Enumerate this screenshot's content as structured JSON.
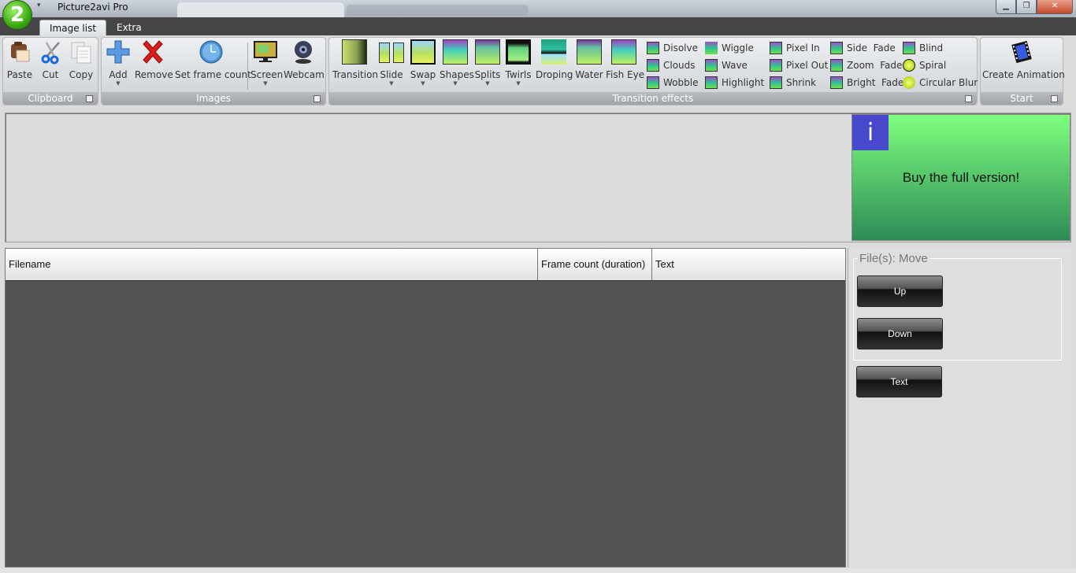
{
  "window": {
    "title": "Picture2avi Pro",
    "logo_glyph": "2",
    "qat_glyph": "▾",
    "controls": {
      "minimize": "▁",
      "maximize": "❐",
      "close": "✕"
    }
  },
  "tabs": [
    {
      "label": "Image list",
      "active": true
    },
    {
      "label": "Extra",
      "active": false
    }
  ],
  "ribbon": {
    "groups": {
      "clipboard": {
        "label": "Clipboard",
        "buttons": [
          {
            "label": "Paste",
            "icon": "paste-icon"
          },
          {
            "label": "Cut",
            "icon": "scissors-icon"
          },
          {
            "label": "Copy",
            "icon": "copy-icon"
          }
        ]
      },
      "images": {
        "label": "Images",
        "buttons": [
          {
            "label": "Add",
            "icon": "plus-icon",
            "dropdown": true
          },
          {
            "label": "Remove",
            "icon": "red-x-icon"
          },
          {
            "label": "Set frame count",
            "icon": "clock-icon"
          },
          {
            "label": "Screen",
            "icon": "monitor-icon",
            "dropdown": true
          },
          {
            "label": "Webcam",
            "icon": "webcam-icon"
          }
        ]
      },
      "transition_effects": {
        "label": "Transition effects",
        "large": [
          {
            "label": "Transition",
            "dropdown": false
          },
          {
            "label": "Slide",
            "dropdown": true
          },
          {
            "label": "Swap",
            "dropdown": true
          },
          {
            "label": "Shapes",
            "dropdown": true
          },
          {
            "label": "Splits",
            "dropdown": true
          },
          {
            "label": "Twirls",
            "dropdown": true
          },
          {
            "label": "Droping",
            "dropdown": false
          },
          {
            "label": "Water",
            "dropdown": false
          },
          {
            "label": "Fish Eye",
            "dropdown": false
          }
        ],
        "small": [
          [
            "Disolve",
            "Clouds",
            "Wobble"
          ],
          [
            "Wiggle",
            "Wave",
            "Highlight"
          ],
          [
            "Pixel In",
            "Pixel Out",
            "Shrink"
          ],
          [
            "Side  Fade",
            "Zoom  Fade",
            "Bright  Fade"
          ],
          [
            "Blind",
            "Spiral",
            "Circular Blur"
          ]
        ]
      },
      "start": {
        "label": "Start",
        "buttons": [
          {
            "label": "Create Animation",
            "icon": "film-icon"
          }
        ]
      }
    }
  },
  "ad": {
    "icon_glyph": "i",
    "message": "Buy the full version!",
    "gradient_top": "#7eff7e",
    "gradient_bottom": "#2e8b57"
  },
  "table": {
    "columns": [
      "Filename",
      "Frame count (duration)",
      "Text"
    ],
    "rows": []
  },
  "side_panel": {
    "move_legend": "File(s): Move",
    "up_label": "Up",
    "down_label": "Down",
    "text_label": "Text"
  }
}
